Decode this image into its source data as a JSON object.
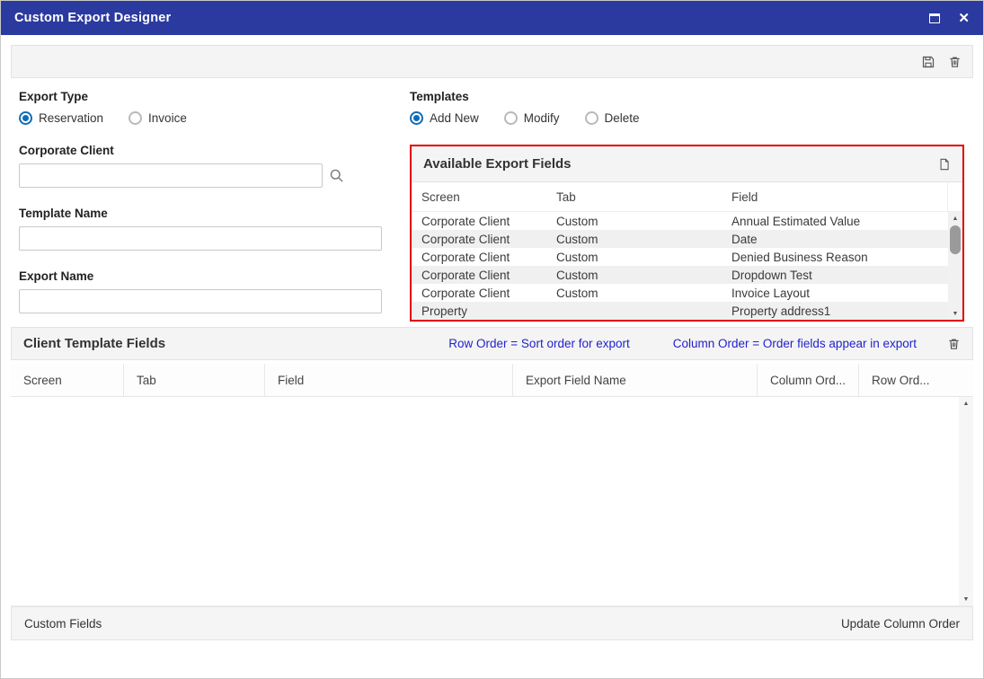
{
  "titlebar": {
    "title": "Custom Export Designer"
  },
  "icons": {
    "close": "✕",
    "scroll_up": "▲",
    "scroll_down": "▼"
  },
  "export_type": {
    "label": "Export Type",
    "options": [
      {
        "label": "Reservation",
        "selected": true
      },
      {
        "label": "Invoice",
        "selected": false
      }
    ]
  },
  "templates": {
    "label": "Templates",
    "options": [
      {
        "label": "Add New",
        "selected": true
      },
      {
        "label": "Modify",
        "selected": false
      },
      {
        "label": "Delete",
        "selected": false
      }
    ]
  },
  "form": {
    "corporate_client": {
      "label": "Corporate Client",
      "value": ""
    },
    "template_name": {
      "label": "Template Name",
      "value": ""
    },
    "export_name": {
      "label": "Export Name",
      "value": ""
    }
  },
  "available_fields": {
    "title": "Available Export Fields",
    "columns": [
      "Screen",
      "Tab",
      "Field"
    ],
    "rows": [
      [
        "Corporate Client",
        "Custom",
        "Annual Estimated Value"
      ],
      [
        "Corporate Client",
        "Custom",
        "Date"
      ],
      [
        "Corporate Client",
        "Custom",
        "Denied Business Reason"
      ],
      [
        "Corporate Client",
        "Custom",
        "Dropdown Test"
      ],
      [
        "Corporate Client",
        "Custom",
        "Invoice Layout"
      ],
      [
        "Property",
        "",
        "Property address1"
      ]
    ]
  },
  "client_template_fields": {
    "title": "Client Template Fields",
    "row_order_link": "Row Order = Sort order for export",
    "column_order_link": "Column Order = Order fields appear in export",
    "columns": [
      "Screen",
      "Tab",
      "Field",
      "Export Field Name",
      "Column Ord...",
      "Row Ord..."
    ],
    "rows": []
  },
  "footer": {
    "custom_fields_label": "Custom Fields",
    "update_column_order_label": "Update Column Order"
  },
  "colors": {
    "titlebar": "#2b3a9f",
    "accent_red": "#e10000",
    "link_blue": "#2222cc",
    "radio_blue": "#0e6cb7"
  }
}
